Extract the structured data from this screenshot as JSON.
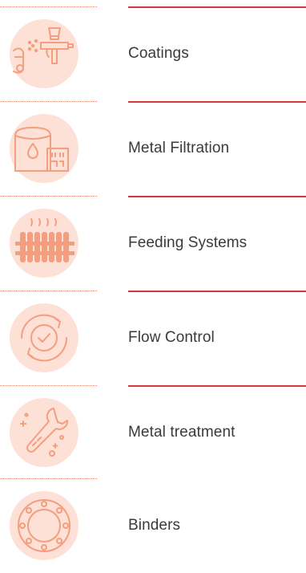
{
  "accent_colors": {
    "circle": "#fde1d6",
    "line": "#f39e7e",
    "divider": "#d23a3f"
  },
  "menu": {
    "items": [
      {
        "label": "Coatings",
        "icon": "spray-gun-icon"
      },
      {
        "label": "Metal Filtration",
        "icon": "filtration-tank-icon"
      },
      {
        "label": "Feeding Systems",
        "icon": "radiator-heater-icon"
      },
      {
        "label": "Flow Control",
        "icon": "circular-check-icon"
      },
      {
        "label": "Metal treatment",
        "icon": "wrench-tool-icon"
      },
      {
        "label": "Binders",
        "icon": "ring-circles-icon"
      }
    ]
  }
}
